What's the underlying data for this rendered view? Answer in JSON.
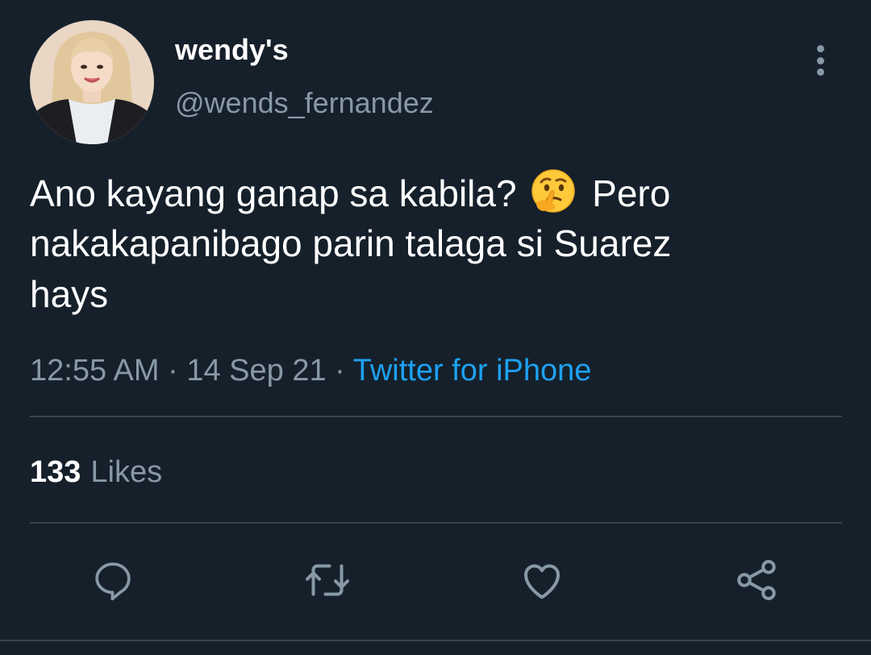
{
  "tweet": {
    "author": {
      "display_name": "wendy's",
      "handle": "@wends_fernandez"
    },
    "text_lines": [
      "Ano kayang ganap sa kabila?",
      "Pero",
      "nakakapanibago parin talaga si Suarez",
      "hays"
    ],
    "emoji": "thinking-face-emoji",
    "time": "12:55 AM",
    "date": "14 Sep 21",
    "separator": "·",
    "source": "Twitter for iPhone",
    "likes_count": "133",
    "likes_label": "Likes"
  },
  "actions": {
    "reply_icon": "reply-icon",
    "retweet_icon": "retweet-icon",
    "like_icon": "heart-icon",
    "share_icon": "share-icon",
    "more_icon": "more-vertical-icon"
  },
  "colors": {
    "background": "#15202b",
    "primary_text": "#ffffff",
    "secondary_text": "#8899a6",
    "link": "#1da1f2",
    "divider": "#38444d"
  }
}
